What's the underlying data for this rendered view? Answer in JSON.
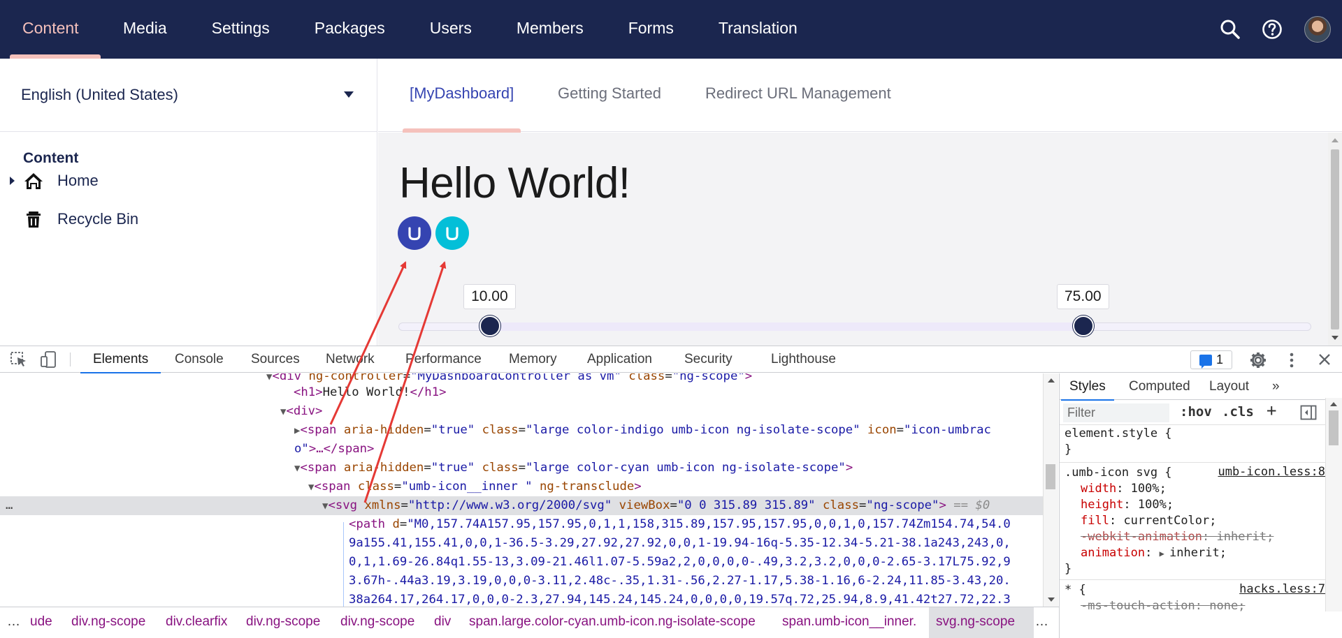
{
  "topbar": {
    "nav": [
      "Content",
      "Media",
      "Settings",
      "Packages",
      "Users",
      "Members",
      "Forms",
      "Translation"
    ],
    "active": "Content",
    "icons": [
      "search-icon",
      "help-icon",
      "user-avatar"
    ]
  },
  "tree": {
    "language": "English (United States)",
    "section_title": "Content",
    "items": [
      {
        "label": "Home",
        "icon": "home-icon",
        "has_children": true
      },
      {
        "label": "Recycle Bin",
        "icon": "trash-icon",
        "has_children": false
      }
    ]
  },
  "dashboard": {
    "tabs": [
      "[MyDashboard]",
      "Getting Started",
      "Redirect URL Management"
    ],
    "heading": "Hello World!",
    "icons": [
      {
        "name": "umbraco-icon-indigo",
        "color": "#3544b1"
      },
      {
        "name": "umbraco-icon-cyan",
        "color": "#03bfd8"
      }
    ],
    "slider": {
      "min": 0,
      "max": 100,
      "low": 10,
      "high": 75,
      "low_label": "10.00",
      "high_label": "75.00"
    }
  },
  "devtools": {
    "tabs": [
      "Elements",
      "Console",
      "Sources",
      "Network",
      "Performance",
      "Memory",
      "Application",
      "Security",
      "Lighthouse"
    ],
    "active_tab": "Elements",
    "issues_count": "1",
    "styles_tabs": [
      "Styles",
      "Computed",
      "Layout",
      "»"
    ],
    "filter_placeholder": "Filter",
    "filter_buttons": [
      ":hov",
      ".cls",
      "+"
    ],
    "breadcrumbs": [
      "…",
      "ude",
      "div.ng-scope",
      "div.clearfix",
      "div.ng-scope",
      "div.ng-scope",
      "div",
      "span.large.color-cyan.umb-icon.ng-isolate-scope",
      "span.umb-icon__inner.",
      "svg.ng-scope",
      "…"
    ],
    "selected_equals": "== $0",
    "code": {
      "l1": {
        "tag_open": "<div",
        "a1": "ng-controller",
        "v1": "\"MyDashboardController as vm\"",
        "a2": "class",
        "v2": "\"ng-scope\"",
        "close": ">"
      },
      "l2": {
        "open": "<h1>",
        "text": "Hello World!",
        "close": "</h1>"
      },
      "l3": {
        "open": "<div>"
      },
      "l4": {
        "tag_open": "<span",
        "a1": "aria-hidden",
        "v1": "\"true\"",
        "a2": "class",
        "v2": "\"large color-indigo umb-icon ng-isolate-scope\"",
        "a3": "icon",
        "v3": "\"icon-umbrac"
      },
      "l5": {
        "cont": "o\"",
        "rest": ">…</span>"
      },
      "l6": {
        "tag_open": "<span",
        "a1": "aria-hidden",
        "v1": "\"true\"",
        "a2": "class",
        "v2": "\"large color-cyan umb-icon ng-isolate-scope\"",
        "close": ">"
      },
      "l7": {
        "tag_open": "<span",
        "a1": "class",
        "v1": "\"umb-icon__inner \"",
        "a2": "ng-transclude",
        "close": ">"
      },
      "l8": {
        "tag_open": "<svg",
        "a1": "xmlns",
        "v1": "\"http://www.w3.org/2000/svg\"",
        "a2": "viewBox",
        "v2": "\"0 0 315.89 315.89\"",
        "a3": "class",
        "v3": "\"ng-scope\"",
        "close": ">"
      },
      "l9": {
        "tag_open": "<path",
        "a1": "d",
        "v1": "\"M0,157.74A157.95,157.95,0,1,1,158,315.89,157.95,157.95,0,0,1,0,157.74Zm154.74,54.0"
      },
      "l10": "9a155.41,155.41,0,0,1-36.5-3.29,27.92,27.92,0,0,1-19.94-16q-5.35-12.34-5.21-38.1a243,243,0,",
      "l11": "0,1,1.69-26.84q1.55-13,3.09-21.46l1.07-5.59a2,2,0,0,0,0-.49,3.2,3.2,0,0,0-2.65-3.17L75.92,9",
      "l12": "3.67h-.44a3.19,3.19,0,0,0-3.11,2.48c-.35,1.31-.56,2.27-1.17,5.38-1.16,6-2.24,11.85-3.43,20.",
      "l13": "38a264.17,264.17,0,0,0-2.3,27.94,145.24,145.24,0,0,0,0,19.57q.72,25.94,8.9,41.42t27.72,22.3"
    },
    "styles": {
      "element_style": "element.style {",
      "brace_close": "}",
      "rule1_selector": ".umb-icon svg {",
      "rule1_source": "umb-icon.less:8",
      "rule1_props": [
        {
          "name": "width",
          "value": "100%;",
          "struck": false
        },
        {
          "name": "height",
          "value": "100%;",
          "struck": false
        },
        {
          "name": "fill",
          "value": "currentColor;",
          "struck": false
        },
        {
          "name": "-webkit-animation",
          "value": "inherit;",
          "struck": true
        },
        {
          "name": "animation",
          "value": "inherit;",
          "struck": false
        }
      ],
      "rule2_selector": "* {",
      "rule2_source": "hacks.less:7",
      "rule2_prop": {
        "name": "-ms-touch-action",
        "value": "none;",
        "struck": true
      }
    }
  },
  "annotation": {
    "color": "#e53935",
    "arrows": [
      "indigo-icon-to-span",
      "cyan-icon-to-svg"
    ]
  }
}
